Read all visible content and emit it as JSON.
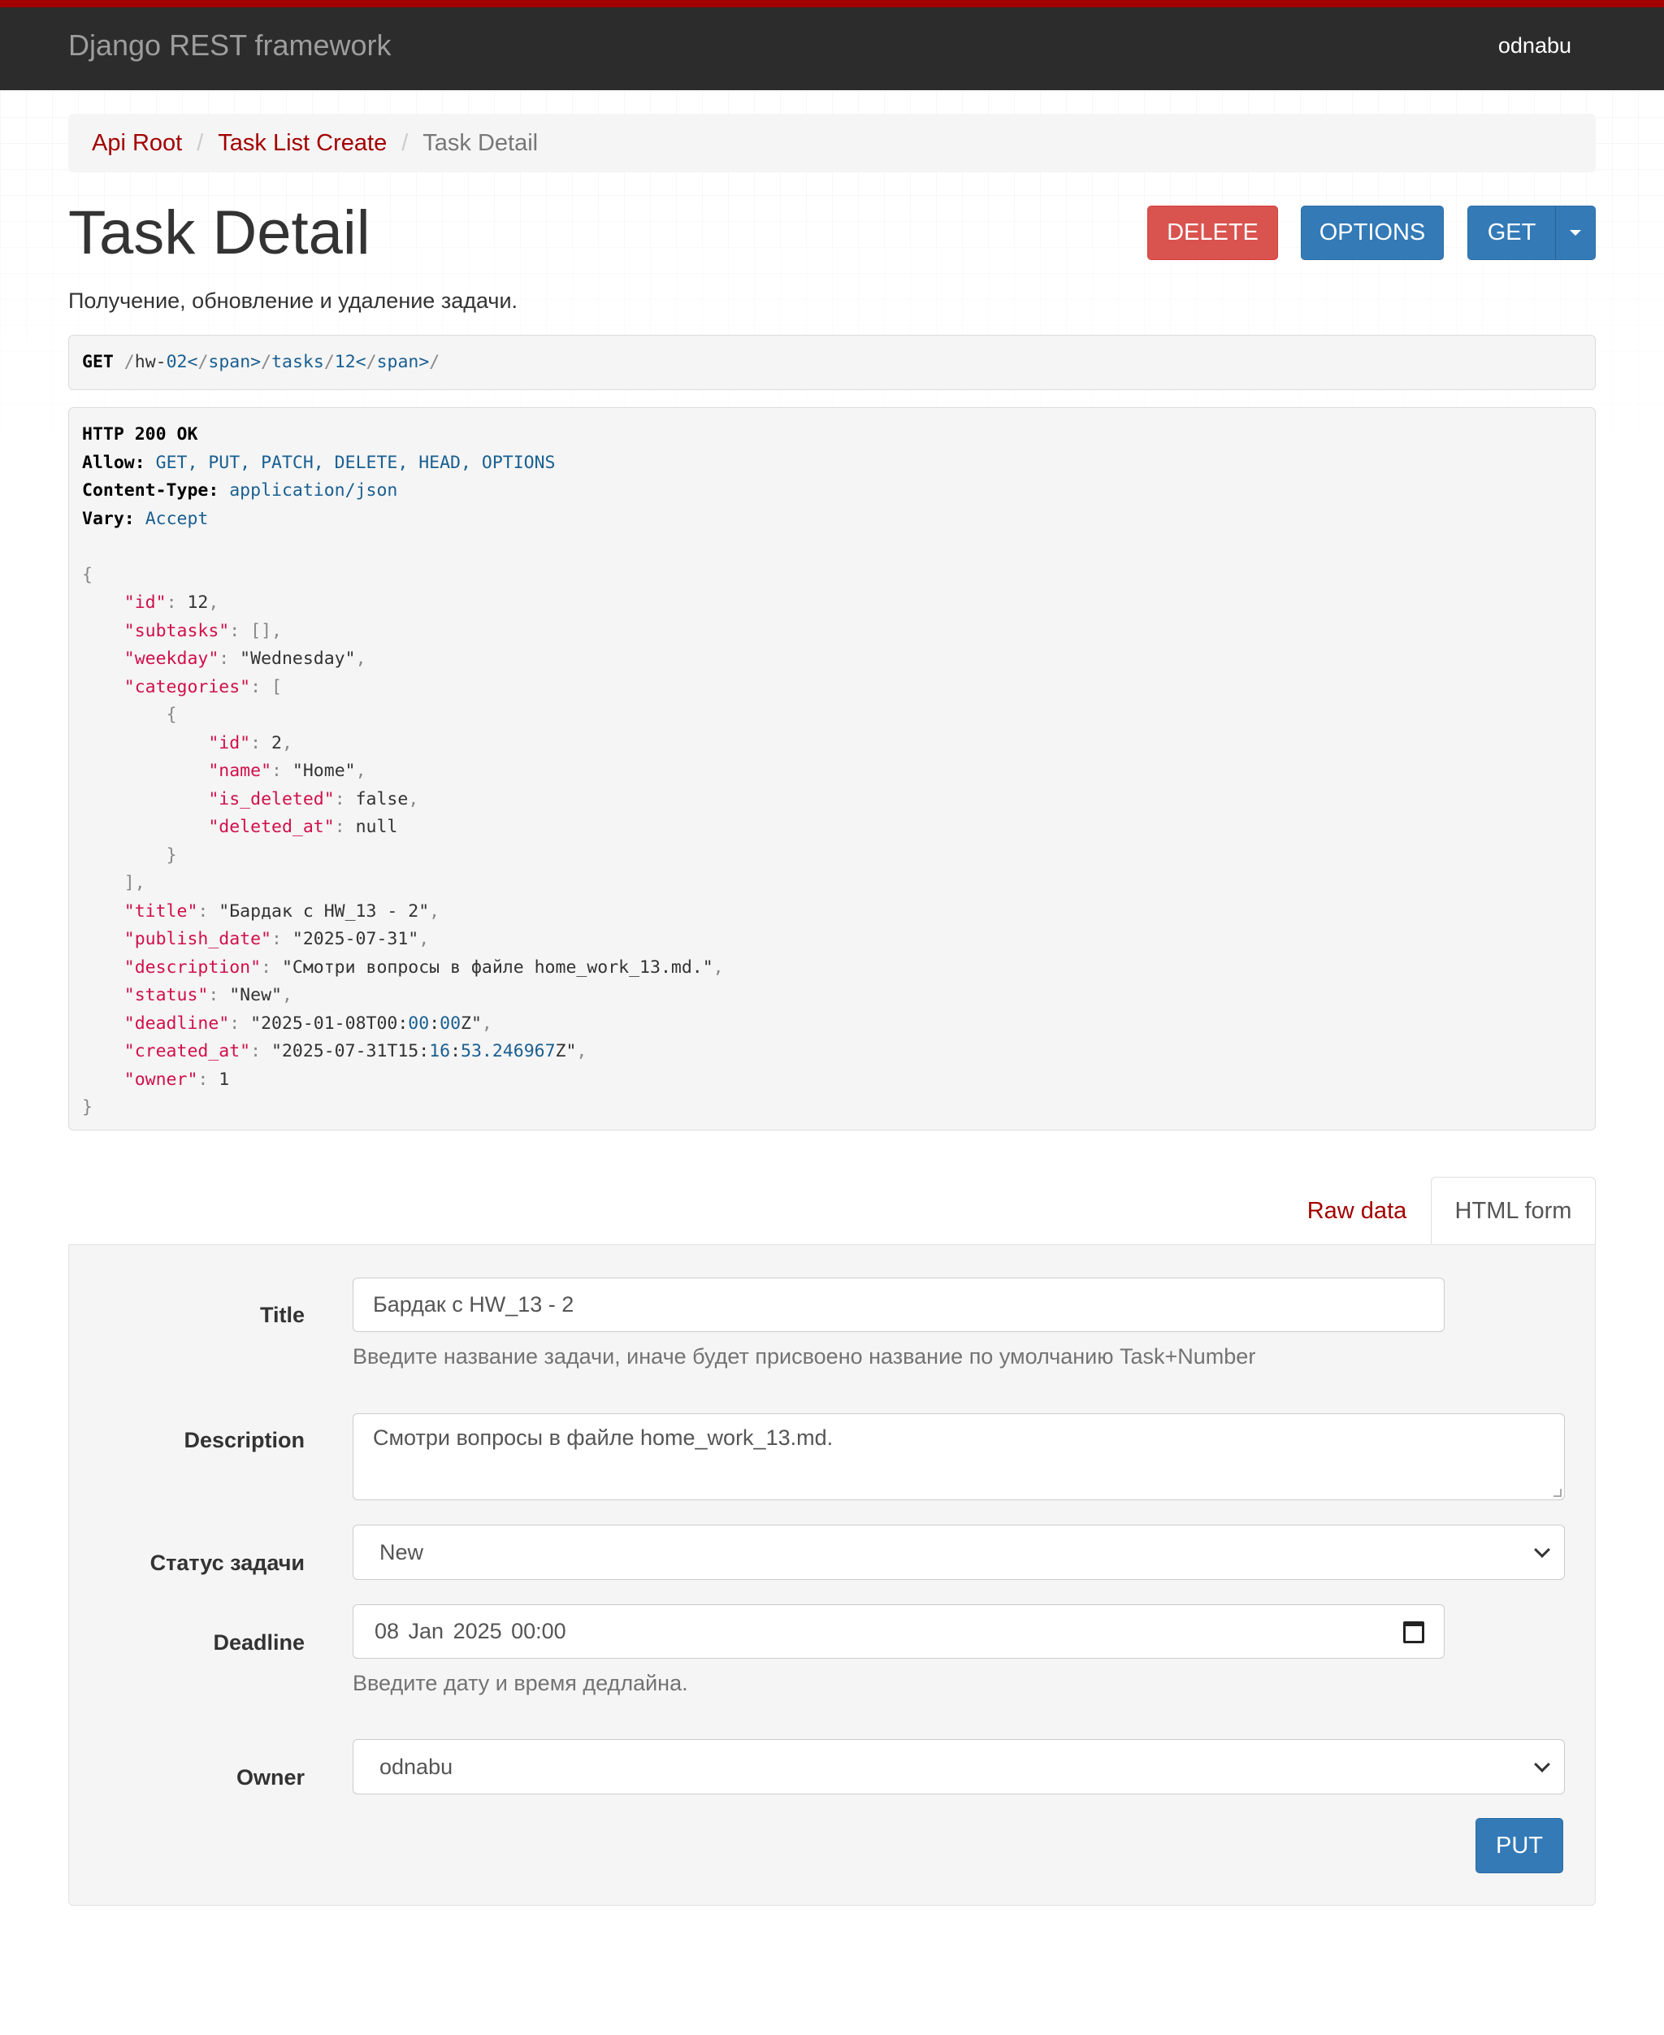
{
  "navbar": {
    "brand": "Django REST framework",
    "user": "odnabu"
  },
  "breadcrumb": {
    "items": [
      "Api Root",
      "Task List Create",
      "Task Detail"
    ],
    "separator": "/"
  },
  "page": {
    "title": "Task Detail",
    "description": "Получение, обновление и удаление задачи."
  },
  "actions": {
    "delete": "DELETE",
    "options": "OPTIONS",
    "get": "GET"
  },
  "request": {
    "method": "GET",
    "path": "/hw-02/tasks/12/"
  },
  "response": {
    "status": "HTTP 200 OK",
    "allow_label": "Allow:",
    "allow_value": "GET, PUT, PATCH, DELETE, HEAD, OPTIONS",
    "ctype_label": "Content-Type:",
    "ctype_value": "application/json",
    "vary_label": "Vary:",
    "vary_value": "Accept",
    "json_lines": [
      "{",
      "    \"id\": 12,",
      "    \"subtasks\": [],",
      "    \"weekday\": \"Wednesday\",",
      "    \"categories\": [",
      "        {",
      "            \"id\": 2,",
      "            \"name\": \"Home\",",
      "            \"is_deleted\": false,",
      "            \"deleted_at\": null",
      "        }",
      "    ],",
      "    \"title\": \"Бардак с HW_13 - 2\",",
      "    \"publish_date\": \"2025-07-31\",",
      "    \"description\": \"Смотри вопросы в файле home_work_13.md.\",",
      "    \"status\": \"New\",",
      "    \"deadline\": \"2025-01-08T00:00:00Z\",",
      "    \"created_at\": \"2025-07-31T15:16:53.246967Z\",",
      "    \"owner\": 1",
      "}"
    ]
  },
  "tabs": {
    "raw": "Raw data",
    "html": "HTML form"
  },
  "form": {
    "title_label": "Title",
    "title_value": "Бардак с HW_13 - 2",
    "title_help": "Введите название задачи, иначе будет присвоено название по умолчанию Task+Number",
    "description_label": "Description",
    "description_value": "Смотри вопросы в файле home_work_13.md.",
    "status_label": "Статус задачи",
    "status_value": "New",
    "deadline_label": "Deadline",
    "deadline_value": "08 Jan 2025 00:00",
    "deadline_help": "Введите дату и время дедлайна.",
    "owner_label": "Owner",
    "owner_value": "odnabu",
    "submit": "PUT"
  },
  "colors": {
    "accent": "#a30000",
    "primary": "#337ab7",
    "danger": "#d9534f",
    "navbar": "#2c2c2c"
  }
}
